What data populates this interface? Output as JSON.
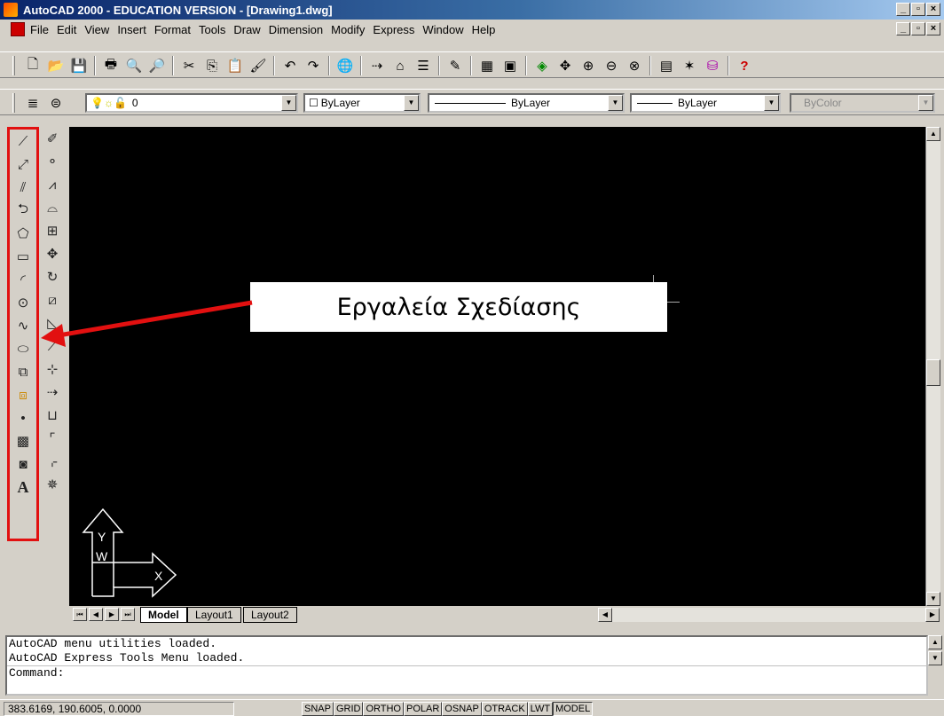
{
  "window": {
    "title": "AutoCAD 2000 - EDUCATION VERSION - [Drawing1.dwg]",
    "controls": [
      "_",
      " ",
      "×"
    ]
  },
  "menu": {
    "items": [
      "File",
      "Edit",
      "View",
      "Insert",
      "Format",
      "Tools",
      "Draw",
      "Dimension",
      "Modify",
      "Express",
      "Window",
      "Help"
    ]
  },
  "properties_toolbar": {
    "layer_value": "0",
    "color_value": "ByLayer",
    "linetype_value": "ByLayer",
    "lineweight_value": "ByLayer",
    "plotstyle_value": "ByColor"
  },
  "annotation": {
    "text": "Εργαλεία Σχεδίασης",
    "arrow_color": "#e21010"
  },
  "tabs": {
    "items": [
      "Model",
      "Layout1",
      "Layout2"
    ],
    "active": "Model"
  },
  "command": {
    "lines": [
      "AutoCAD menu utilities loaded.",
      "AutoCAD Express Tools Menu loaded."
    ],
    "prompt": "Command:"
  },
  "status": {
    "coordinates": "383.6169, 190.6005, 0.0000",
    "toggles": [
      "SNAP",
      "GRID",
      "ORTHO",
      "POLAR",
      "OSNAP",
      "OTRACK",
      "LWT",
      "MODEL"
    ],
    "pressed": "MODEL"
  },
  "icons": {
    "standard": [
      "new-icon",
      "open-icon",
      "save-icon",
      "print-icon",
      "print-preview-icon",
      "find-icon",
      "cut-icon",
      "copy-icon",
      "paste-icon",
      "match-properties-icon",
      "undo-icon",
      "redo-icon",
      "hyperlink-icon",
      "tracking-icon",
      "pan-icon",
      "zoom-icon",
      "properties-icon",
      "help-icon"
    ],
    "draw": [
      "line-icon",
      "construction-line-icon",
      "multiline-icon",
      "polyline-icon",
      "polygon-icon",
      "rectangle-icon",
      "arc-icon",
      "circle-icon",
      "spline-icon",
      "ellipse-icon",
      "insert-block-icon",
      "make-block-icon",
      "point-icon",
      "hatch-icon",
      "region-icon",
      "multiline-text-icon"
    ],
    "modify": [
      "erase-icon",
      "copy-object-icon",
      "mirror-icon",
      "offset-icon",
      "array-icon",
      "move-icon",
      "rotate-icon",
      "scale-icon",
      "stretch-icon",
      "lengthen-icon",
      "trim-icon",
      "extend-icon",
      "break-icon",
      "chamfer-icon",
      "fillet-icon",
      "explode-icon"
    ]
  }
}
